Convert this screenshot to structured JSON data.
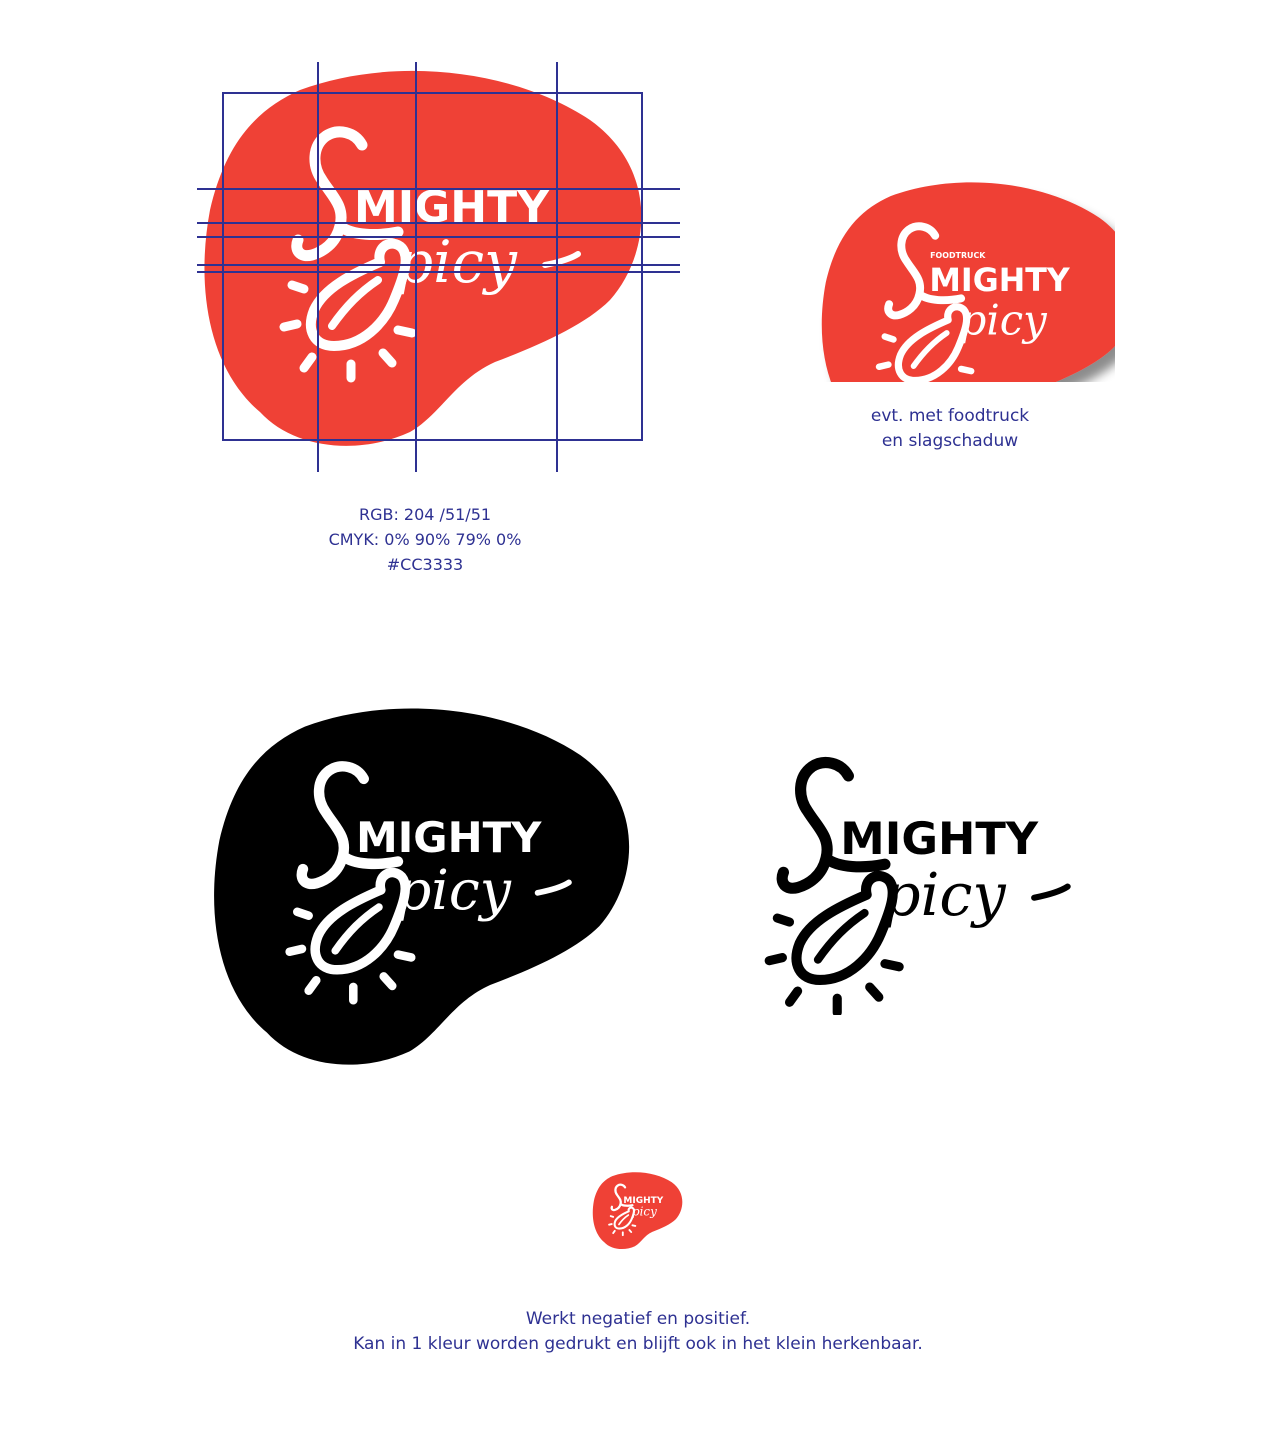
{
  "brand": {
    "word_top": "MIGHTY",
    "word_script": "picy",
    "badge_word": "FOODTRUCK",
    "red": "#ef4136",
    "guide_line_color": "#2e3192",
    "black": "#000000",
    "white": "#ffffff"
  },
  "color_specs": {
    "rgb": "RGB: 204 /51/51",
    "cmyk": "CMYK: 0% 90% 79% 0%",
    "hex": "#CC3333"
  },
  "shadow_caption": {
    "line1": "evt. met foodtruck",
    "line2": "en slagschaduw"
  },
  "bottom_caption": {
    "line1": "Werkt negatief en positief.",
    "line2": "Kan in 1 kleur worden gedrukt en blijft ook in het klein herkenbaar."
  }
}
